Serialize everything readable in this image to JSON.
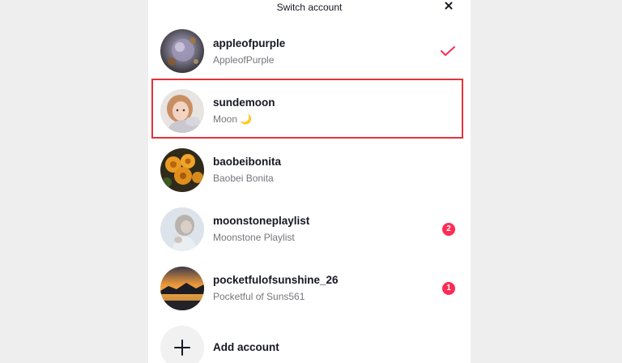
{
  "header": {
    "title": "Switch account",
    "close_icon": "close-icon"
  },
  "accounts": [
    {
      "username": "appleofpurple",
      "nickname": "AppleofPurple",
      "selected": true,
      "status_icon": "checkmark-icon"
    },
    {
      "username": "sundemoon",
      "nickname": "Moon 🌙",
      "highlighted": true
    },
    {
      "username": "baobeibonita",
      "nickname": "Baobei Bonita"
    },
    {
      "username": "moonstoneplaylist",
      "nickname": "Moonstone Playlist",
      "badge": "2"
    },
    {
      "username": "pocketfulofsunshine_26",
      "nickname": "Pocketful of Suns561",
      "badge": "1"
    }
  ],
  "add_account": {
    "label": "Add account",
    "icon": "plus-icon"
  },
  "colors": {
    "accent": "#fe2c55",
    "highlight_border": "#e5333b",
    "text_primary": "#161823",
    "text_secondary": "#75767b"
  }
}
